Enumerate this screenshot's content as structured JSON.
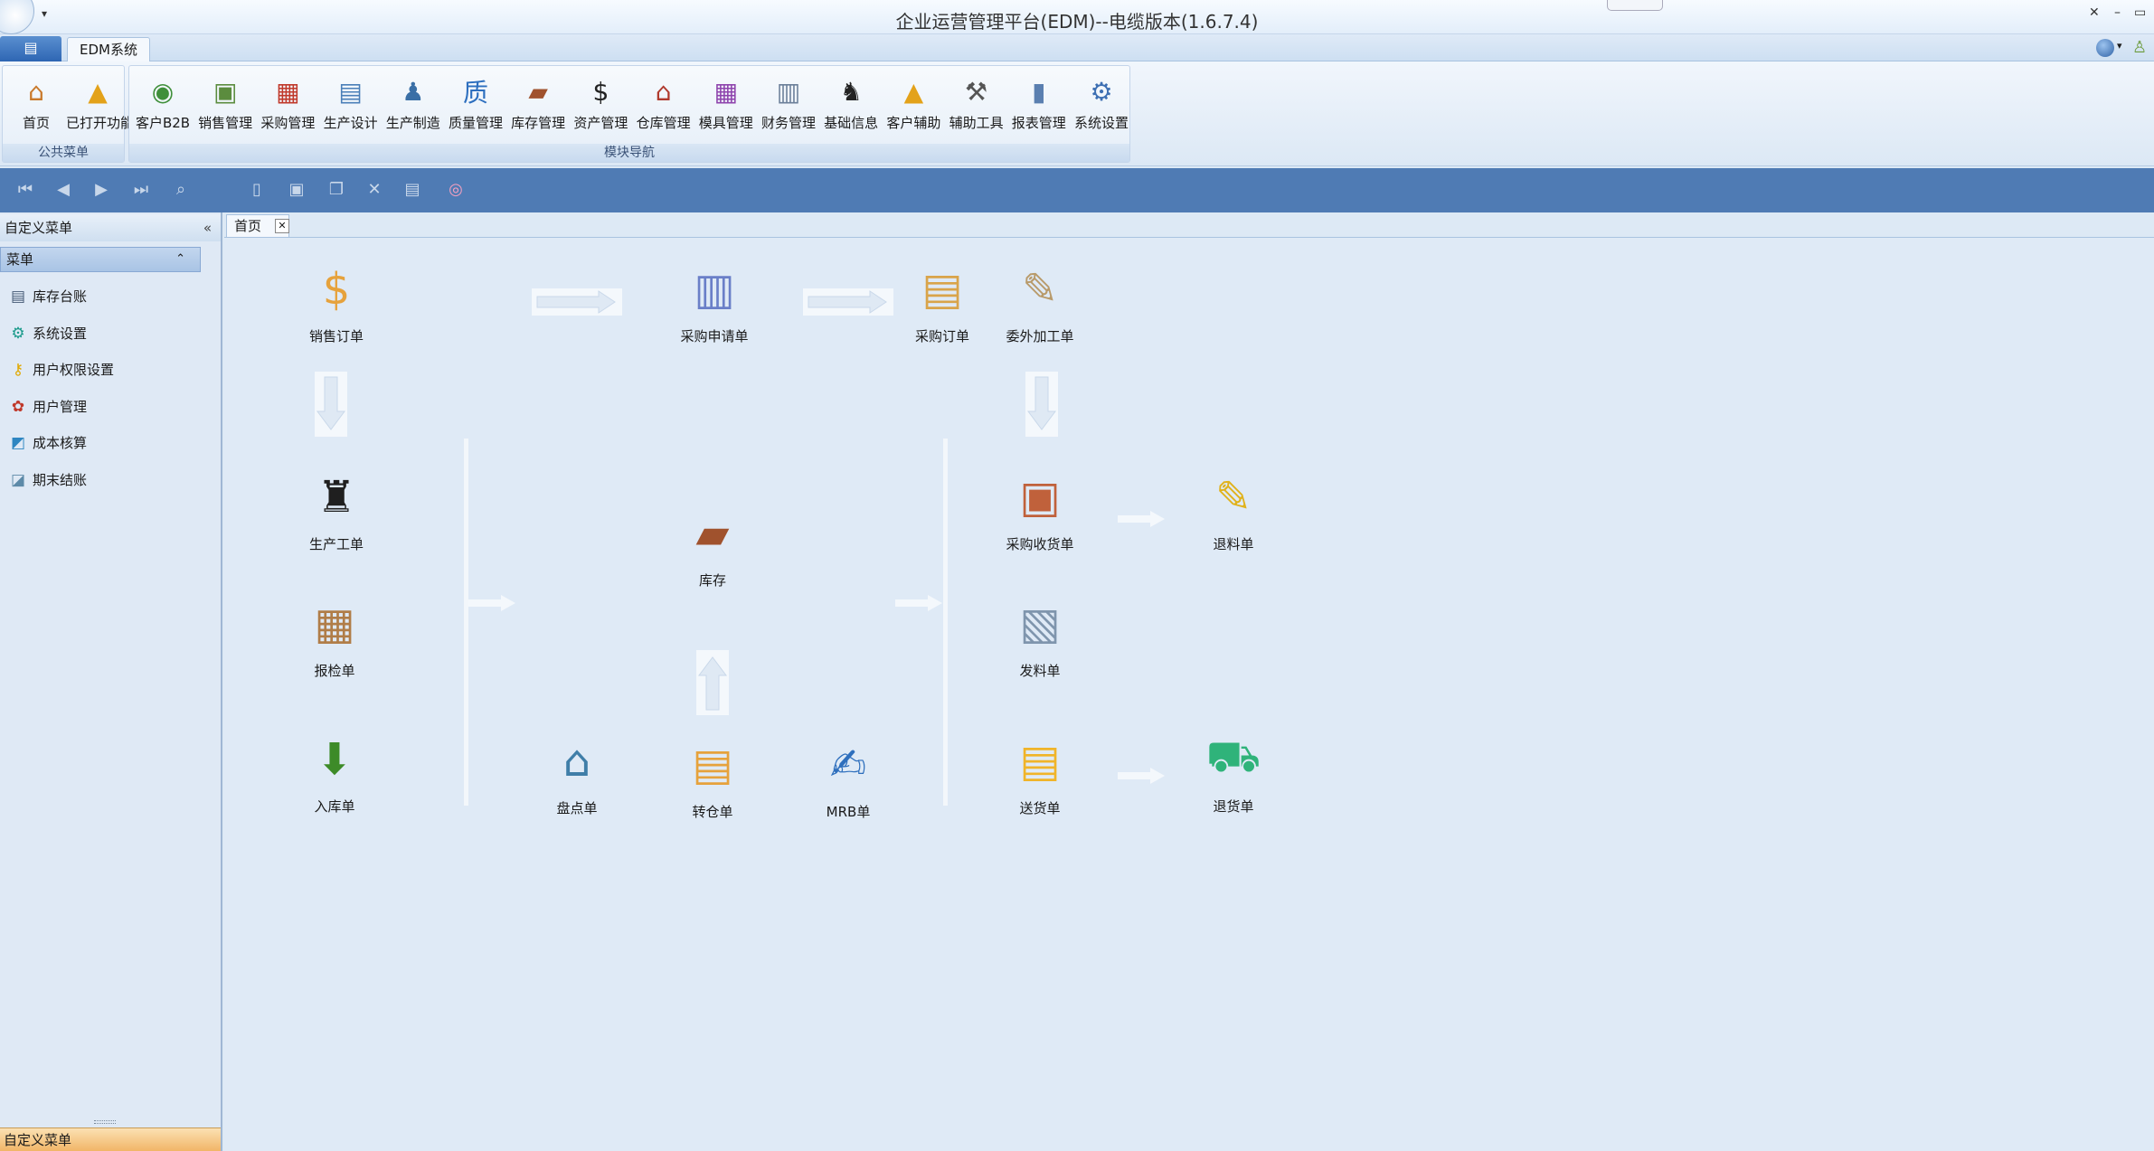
{
  "window": {
    "title": "企业运营管理平台(EDM)--电缆版本(1.6.7.4)",
    "controls": [
      "✕",
      "–",
      "▭"
    ]
  },
  "ribbon_tabs": {
    "app_menu_icon": "▤",
    "active_tab": "EDM系统"
  },
  "ribbon": {
    "groups": [
      {
        "caption": "公共菜单",
        "items": [
          {
            "label": "首页",
            "icon": "home-icon",
            "glyph": "⌂",
            "color": "#c9792b"
          },
          {
            "label": "已打开功能",
            "icon": "open-functions-icon",
            "glyph": "▲",
            "color": "#e3a21a"
          }
        ]
      },
      {
        "caption": "模块导航",
        "items": [
          {
            "label": "客户B2B",
            "icon": "globe-icon",
            "glyph": "◉",
            "color": "#3f8f3a"
          },
          {
            "label": "销售管理",
            "icon": "sales-icon",
            "glyph": "▣",
            "color": "#5b8c3e"
          },
          {
            "label": "采购管理",
            "icon": "cart-icon",
            "glyph": "▦",
            "color": "#c0392b"
          },
          {
            "label": "生产设计",
            "icon": "design-icon",
            "glyph": "▤",
            "color": "#4a7fb8"
          },
          {
            "label": "生产制造",
            "icon": "worker-icon",
            "glyph": "♟",
            "color": "#3a6fa6"
          },
          {
            "label": "质量管理",
            "icon": "shield-icon",
            "glyph": "质",
            "color": "#2d6fbf"
          },
          {
            "label": "库存管理",
            "icon": "box-icon",
            "glyph": "▰",
            "color": "#a0522d"
          },
          {
            "label": "资产管理",
            "icon": "coins-icon",
            "glyph": "$",
            "color": "#222222"
          },
          {
            "label": "仓库管理",
            "icon": "warehouse-icon",
            "glyph": "⌂",
            "color": "#b03a2e"
          },
          {
            "label": "模具管理",
            "icon": "grid-icon",
            "glyph": "▦",
            "color": "#8e44ad"
          },
          {
            "label": "财务管理",
            "icon": "calculator-icon",
            "glyph": "▥",
            "color": "#6b7f99"
          },
          {
            "label": "基础信息",
            "icon": "chess-icon",
            "glyph": "♞",
            "color": "#222222"
          },
          {
            "label": "客户辅助",
            "icon": "service-icon",
            "glyph": "▲",
            "color": "#e3a21a"
          },
          {
            "label": "辅助工具",
            "icon": "hammer-icon",
            "glyph": "⚒",
            "color": "#555555"
          },
          {
            "label": "报表管理",
            "icon": "report-icon",
            "glyph": "▮",
            "color": "#5a7fb0"
          },
          {
            "label": "系统设置",
            "icon": "gears-icon",
            "glyph": "⚙",
            "color": "#3d6fb3"
          }
        ]
      }
    ]
  },
  "toolbar": {
    "buttons": [
      {
        "name": "first-record-icon",
        "glyph": "⏮"
      },
      {
        "name": "previous-record-icon",
        "glyph": "◀"
      },
      {
        "name": "next-record-icon",
        "glyph": "▶"
      },
      {
        "name": "last-record-icon",
        "glyph": "⏭"
      },
      {
        "name": "search-icon",
        "glyph": "⌕"
      },
      {
        "name": "new-document-icon",
        "glyph": "▯"
      },
      {
        "name": "save-icon",
        "glyph": "▣"
      },
      {
        "name": "copy-icon",
        "glyph": "❐"
      },
      {
        "name": "delete-icon",
        "glyph": "✕"
      },
      {
        "name": "print-icon",
        "glyph": "▤"
      },
      {
        "name": "help-lifebuoy-icon",
        "glyph": "◎"
      }
    ]
  },
  "sidebar": {
    "header": "自定义菜单",
    "collapse_glyph": "«",
    "section": "菜单",
    "section_chevron": "⌃",
    "items": [
      {
        "label": "库存台账",
        "icon": "ledger-icon",
        "glyph": "▤",
        "color": "#455a75"
      },
      {
        "label": "系统设置",
        "icon": "settings-icon",
        "glyph": "⚙",
        "color": "#1a9a8a"
      },
      {
        "label": "用户权限设置",
        "icon": "key-icon",
        "glyph": "⚷",
        "color": "#e0a800"
      },
      {
        "label": "用户管理",
        "icon": "users-icon",
        "glyph": "✿",
        "color": "#c0392b"
      },
      {
        "label": "成本核算",
        "icon": "cost-icon",
        "glyph": "◩",
        "color": "#2e86c1"
      },
      {
        "label": "期末结账",
        "icon": "closing-icon",
        "glyph": "◪",
        "color": "#5d8aa8"
      }
    ],
    "footer": "自定义菜单"
  },
  "doc_tab": {
    "label": "首页",
    "close_glyph": "✕"
  },
  "flow": {
    "nodes": [
      {
        "id": "sales-order",
        "label": "销售订单",
        "icon": "invoice-icon",
        "glyph": "$",
        "color": "#e6a23c"
      },
      {
        "id": "purchase-request",
        "label": "采购申请单",
        "icon": "bar-chart-icon",
        "glyph": "▥",
        "color": "#6a7fc8"
      },
      {
        "id": "purchase-order",
        "label": "采购订单",
        "icon": "document-icon",
        "glyph": "▤",
        "color": "#d9a44a"
      },
      {
        "id": "outsourcing-order",
        "label": "委外加工单",
        "icon": "memo-icon",
        "glyph": "✎",
        "color": "#b89a6a"
      },
      {
        "id": "production-order",
        "label": "生产工单",
        "icon": "mover-icon",
        "glyph": "♜",
        "color": "#1f1f1f"
      },
      {
        "id": "inventory",
        "label": "库存",
        "icon": "inventory-box-icon",
        "glyph": "▰",
        "color": "#a0522d"
      },
      {
        "id": "purchase-receipt",
        "label": "采购收货单",
        "icon": "clipboard-icon",
        "glyph": "▣",
        "color": "#c0613b"
      },
      {
        "id": "return-material",
        "label": "退料单",
        "icon": "note-edit-icon",
        "glyph": "✎",
        "color": "#e0b21c"
      },
      {
        "id": "inspection",
        "label": "报检单",
        "icon": "handtruck-icon",
        "glyph": "▦",
        "color": "#b07d48"
      },
      {
        "id": "material-issue",
        "label": "发料单",
        "icon": "notepad-icon",
        "glyph": "▧",
        "color": "#7f95ad"
      },
      {
        "id": "stock-in",
        "label": "入库单",
        "icon": "coins-down-icon",
        "glyph": "⬇",
        "color": "#3d8b28"
      },
      {
        "id": "stocktake",
        "label": "盘点单",
        "icon": "garage-icon",
        "glyph": "⌂",
        "color": "#3f7ea8"
      },
      {
        "id": "transfer",
        "label": "转仓单",
        "icon": "files-icon",
        "glyph": "▤",
        "color": "#e6a23c"
      },
      {
        "id": "mrb",
        "label": "MRB单",
        "icon": "notebook-pen-icon",
        "glyph": "✍",
        "color": "#2e6fbd"
      },
      {
        "id": "delivery",
        "label": "送货单",
        "icon": "sticky-notes-icon",
        "glyph": "▤",
        "color": "#f0b429"
      },
      {
        "id": "return-goods",
        "label": "退货单",
        "icon": "truck-icon",
        "glyph": "⛟",
        "color": "#2fb37a"
      }
    ]
  }
}
